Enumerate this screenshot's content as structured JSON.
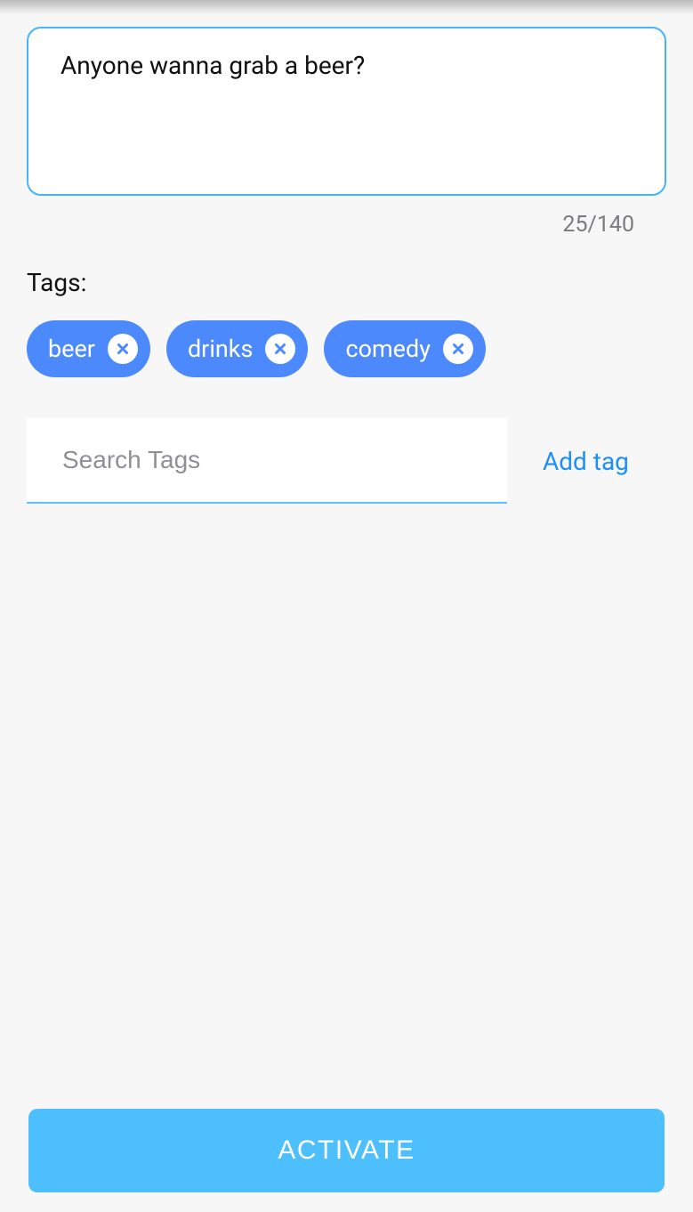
{
  "compose": {
    "text": "Anyone wanna grab a beer?",
    "char_count": "25/140"
  },
  "tags_section": {
    "label": "Tags:",
    "items": [
      {
        "label": "beer"
      },
      {
        "label": "drinks"
      },
      {
        "label": "comedy"
      }
    ],
    "search_placeholder": "Search Tags",
    "add_tag_label": "Add tag"
  },
  "footer": {
    "activate_label": "ACTIVATE"
  }
}
